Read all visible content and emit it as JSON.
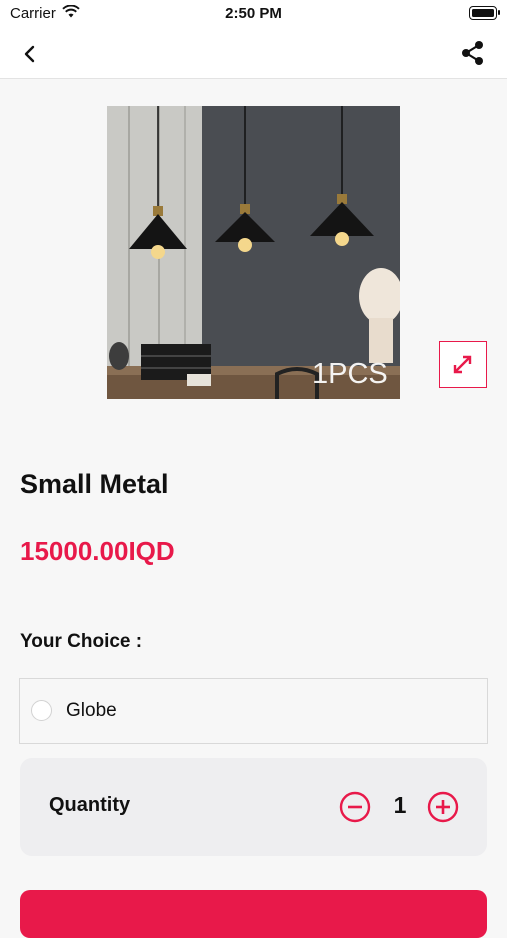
{
  "status_bar": {
    "carrier": "Carrier",
    "time": "2:50 PM"
  },
  "nav": {
    "back_icon": "chevron-left-icon",
    "share_icon": "share-icon"
  },
  "product": {
    "image_caption": "1PCS",
    "title": "Small Metal",
    "price": "15000.00IQD",
    "expand_icon": "expand-icon"
  },
  "options": {
    "label": "Your Choice :",
    "items": [
      {
        "label": "Globe",
        "selected": false
      }
    ]
  },
  "quantity": {
    "label": "Quantity",
    "value": "1",
    "minus_icon": "minus-circle-icon",
    "plus_icon": "plus-circle-icon"
  },
  "colors": {
    "accent": "#e8194a",
    "background": "#f7f7f7"
  }
}
